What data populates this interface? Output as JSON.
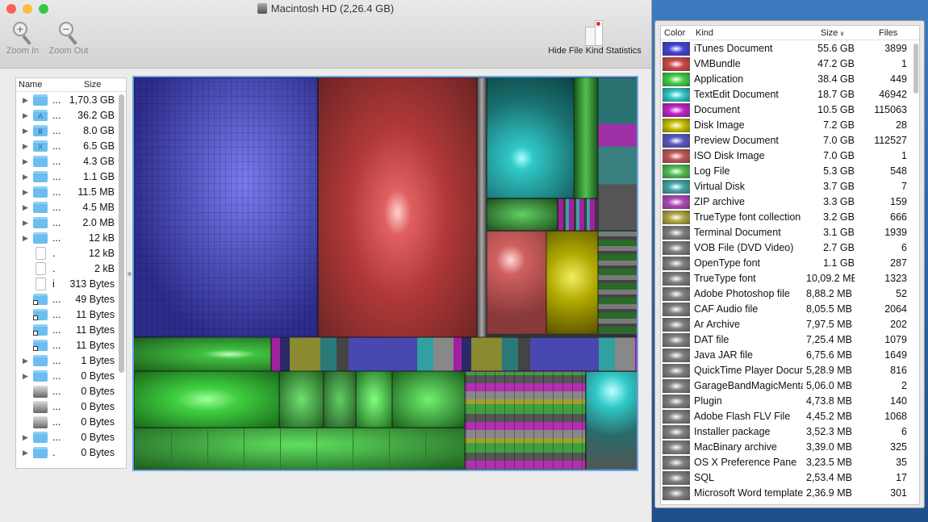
{
  "window": {
    "title": "Macintosh HD (2,26.4 GB)"
  },
  "toolbar": {
    "zoom_in": "Zoom In",
    "zoom_out": "Zoom Out",
    "hide_stats": "Hide File Kind Statistics"
  },
  "outline": {
    "headers": {
      "name": "Name",
      "size": "Size"
    },
    "rows": [
      {
        "expand": true,
        "icon": "user-folder",
        "name": "...",
        "size": "1,70.3 GB"
      },
      {
        "expand": true,
        "icon": "applications-folder",
        "name": "...",
        "size": "36.2 GB"
      },
      {
        "expand": true,
        "icon": "library-folder",
        "name": "...",
        "size": "8.0 GB"
      },
      {
        "expand": true,
        "icon": "system-folder",
        "name": "...",
        "size": "6.5 GB"
      },
      {
        "expand": true,
        "icon": "folder",
        "name": "...",
        "size": "4.3 GB"
      },
      {
        "expand": true,
        "icon": "folder",
        "name": "...",
        "size": "1.1 GB"
      },
      {
        "expand": true,
        "icon": "folder",
        "name": "...",
        "size": "11.5 MB"
      },
      {
        "expand": true,
        "icon": "folder",
        "name": "...",
        "size": "4.5 MB"
      },
      {
        "expand": true,
        "icon": "folder",
        "name": "...",
        "size": "2.0 MB"
      },
      {
        "expand": true,
        "icon": "folder",
        "name": "...",
        "size": "12 kB"
      },
      {
        "expand": false,
        "icon": "document",
        "name": ".",
        "size": "12 kB"
      },
      {
        "expand": false,
        "icon": "document",
        "name": ".",
        "size": "2 kB"
      },
      {
        "expand": false,
        "icon": "document",
        "name": "i",
        "size": "313 Bytes"
      },
      {
        "expand": false,
        "icon": "alias-folder",
        "name": "...",
        "size": "49 Bytes"
      },
      {
        "expand": false,
        "icon": "alias-folder",
        "name": "...",
        "size": "11 Bytes"
      },
      {
        "expand": false,
        "icon": "alias-folder",
        "name": "...",
        "size": "11 Bytes"
      },
      {
        "expand": false,
        "icon": "alias-folder",
        "name": "...",
        "size": "11 Bytes"
      },
      {
        "expand": true,
        "icon": "folder",
        "name": "...",
        "size": "1 Bytes"
      },
      {
        "expand": true,
        "icon": "folder",
        "name": "...",
        "size": "0 Bytes"
      },
      {
        "expand": false,
        "icon": "network-drive",
        "name": "...",
        "size": "0 Bytes"
      },
      {
        "expand": false,
        "icon": "network-drive",
        "name": "...",
        "size": "0 Bytes"
      },
      {
        "expand": false,
        "icon": "hard-drive",
        "name": "...",
        "size": "0 Bytes"
      },
      {
        "expand": true,
        "icon": "folder",
        "name": "...",
        "size": "0 Bytes"
      },
      {
        "expand": true,
        "icon": "folder",
        "name": ".",
        "size": "0 Bytes"
      }
    ]
  },
  "kinds": {
    "headers": {
      "color": "Color",
      "kind": "Kind",
      "size": "Size",
      "files": "Files"
    },
    "rows": [
      {
        "color": "#4040d8",
        "kind": "iTunes Document",
        "size": "55.6 GB",
        "files": "3899"
      },
      {
        "color": "#d04848",
        "kind": "VMBundle",
        "size": "47.2 GB",
        "files": "1"
      },
      {
        "color": "#40d040",
        "kind": "Application",
        "size": "38.4 GB",
        "files": "449"
      },
      {
        "color": "#30c8c8",
        "kind": "TextEdit Document",
        "size": "18.7 GB",
        "files": "46942"
      },
      {
        "color": "#c020c8",
        "kind": "Document",
        "size": "10.5 GB",
        "files": "115063"
      },
      {
        "color": "#c8c000",
        "kind": "Disk Image",
        "size": "7.2 GB",
        "files": "28"
      },
      {
        "color": "#5858c0",
        "kind": "Preview Document",
        "size": "7.0 GB",
        "files": "112527"
      },
      {
        "color": "#c05858",
        "kind": "ISO Disk Image",
        "size": "7.0 GB",
        "files": "1"
      },
      {
        "color": "#50c050",
        "kind": "Log File",
        "size": "5.3 GB",
        "files": "548"
      },
      {
        "color": "#40a8a8",
        "kind": "Virtual Disk",
        "size": "3.7 GB",
        "files": "7"
      },
      {
        "color": "#b048b8",
        "kind": "ZIP archive",
        "size": "3.3 GB",
        "files": "159"
      },
      {
        "color": "#b0a840",
        "kind": "TrueType font collection",
        "size": "3.2 GB",
        "files": "666"
      },
      {
        "color": "#808080",
        "kind": "Terminal Document",
        "size": "3.1 GB",
        "files": "1939"
      },
      {
        "color": "#808080",
        "kind": "VOB File (DVD Video)",
        "size": "2.7 GB",
        "files": "6"
      },
      {
        "color": "#808080",
        "kind": "OpenType font",
        "size": "1.1 GB",
        "files": "287"
      },
      {
        "color": "#808080",
        "kind": "TrueType font",
        "size": "10,09.2 MB",
        "files": "1323"
      },
      {
        "color": "#808080",
        "kind": "Adobe Photoshop file",
        "size": "8,88.2 MB",
        "files": "52"
      },
      {
        "color": "#808080",
        "kind": "CAF Audio file",
        "size": "8,05.5 MB",
        "files": "2064"
      },
      {
        "color": "#808080",
        "kind": "Ar Archive",
        "size": "7,97.5 MB",
        "files": "202"
      },
      {
        "color": "#808080",
        "kind": "DAT file",
        "size": "7,25.4 MB",
        "files": "1079"
      },
      {
        "color": "#808080",
        "kind": "Java JAR file",
        "size": "6,75.6 MB",
        "files": "1649"
      },
      {
        "color": "#808080",
        "kind": "QuickTime Player Document",
        "size": "5,28.9 MB",
        "files": "816"
      },
      {
        "color": "#808080",
        "kind": "GarageBandMagicMenta",
        "size": "5,06.0 MB",
        "files": "2"
      },
      {
        "color": "#808080",
        "kind": "Plugin",
        "size": "4,73.8 MB",
        "files": "140"
      },
      {
        "color": "#808080",
        "kind": "Adobe Flash FLV File",
        "size": "4,45.2 MB",
        "files": "1068"
      },
      {
        "color": "#808080",
        "kind": "Installer package",
        "size": "3,52.3 MB",
        "files": "6"
      },
      {
        "color": "#808080",
        "kind": "MacBinary archive",
        "size": "3,39.0 MB",
        "files": "325"
      },
      {
        "color": "#808080",
        "kind": "OS X Preference Pane",
        "size": "3,23.5 MB",
        "files": "35"
      },
      {
        "color": "#808080",
        "kind": "SQL",
        "size": "2,53.4 MB",
        "files": "17"
      },
      {
        "color": "#808080",
        "kind": "Microsoft Word template",
        "size": "2,36.9 MB",
        "files": "301"
      }
    ]
  }
}
